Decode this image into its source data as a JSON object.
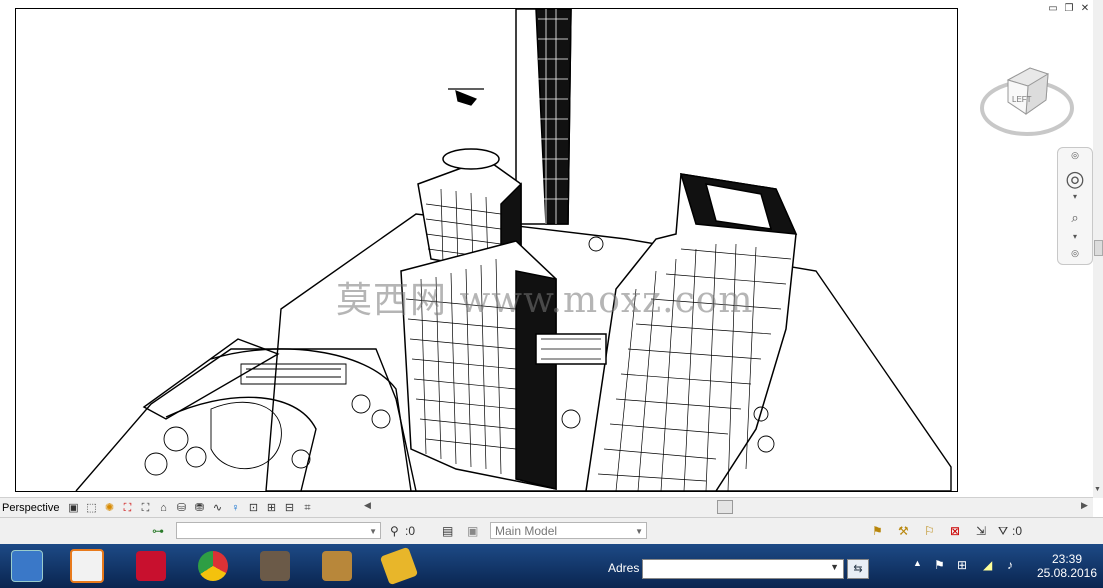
{
  "window_controls": {
    "minimize": "▭",
    "restore": "❐",
    "close": "✕"
  },
  "viewport": {
    "watermark": "莫西网 www.moxz.com"
  },
  "viewcube": {
    "face_label": "LEFT"
  },
  "viewbar": {
    "view_type": "Perspective",
    "icons": [
      "visual-style",
      "shadows",
      "sun-path",
      "crop-view",
      "show-crop",
      "unlock-3d",
      "temporary-hide",
      "reveal-hidden",
      "analytical-model",
      "highlight-displacement",
      "show-constraints",
      "worksharing",
      "design-options"
    ]
  },
  "statusbar": {
    "workset_value": "",
    "pick_count": ":0",
    "model_value": "Main Model",
    "filter_count": ":0"
  },
  "taskbar": {
    "address_label": "Adres",
    "address_value": "",
    "clock_time": "23:39",
    "clock_date": "25.08.2016",
    "tray_arrow": "▲"
  },
  "colors": {
    "taskbar": "#0c2d5c",
    "autocad_red": "#c8102e",
    "chrome_green": "#2e9e44"
  }
}
